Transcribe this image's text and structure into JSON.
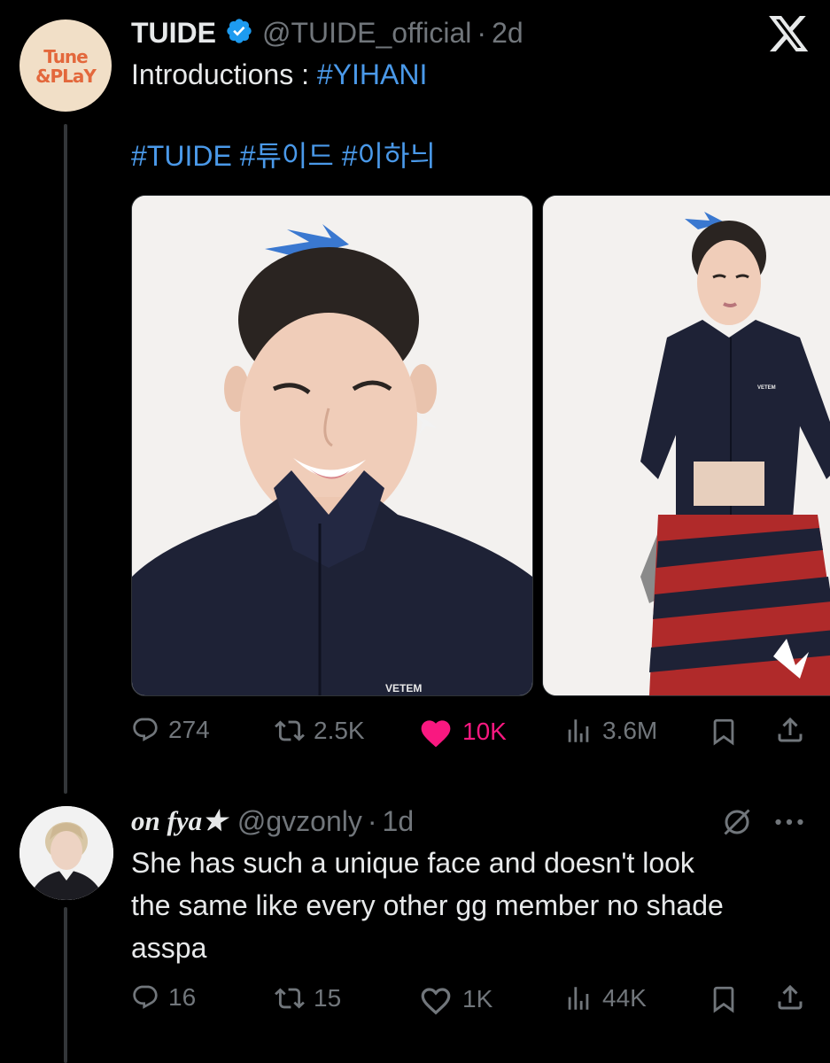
{
  "colors": {
    "background": "#000000",
    "text": "#e7e9ea",
    "muted": "#71767b",
    "link": "#4a99e9",
    "verified": "#1d9bf0",
    "like": "#f91880"
  },
  "post": {
    "avatar_logo_line1": "Tune",
    "avatar_logo_line2": "&PLaY",
    "display_name": "TUIDE",
    "handle": "@TUIDE_official",
    "time": "2d",
    "text_prefix": "Introductions : ",
    "hashtag_main": "#YIHANI",
    "hashtags": [
      "#TUIDE",
      "#튜이드",
      "#이하늬"
    ],
    "platform_icon": "x-logo-icon",
    "images": [
      {
        "name": "photo-portrait-close-up",
        "watermark": "VETEM"
      },
      {
        "name": "photo-full-outfit",
        "watermark": "VETEM"
      }
    ],
    "actions": {
      "replies": "274",
      "reposts": "2.5K",
      "likes": "10K",
      "views": "3.6M"
    }
  },
  "reply": {
    "display_name": "on fya★",
    "handle": "@gvzonly",
    "time": "1d",
    "text_line1": "She has such a unique face and doesn't look",
    "text_line2": "the same like every other gg member no shade",
    "text_line3": "asspa",
    "actions": {
      "replies": "16",
      "reposts": "15",
      "likes": "1K",
      "views": "44K"
    }
  }
}
